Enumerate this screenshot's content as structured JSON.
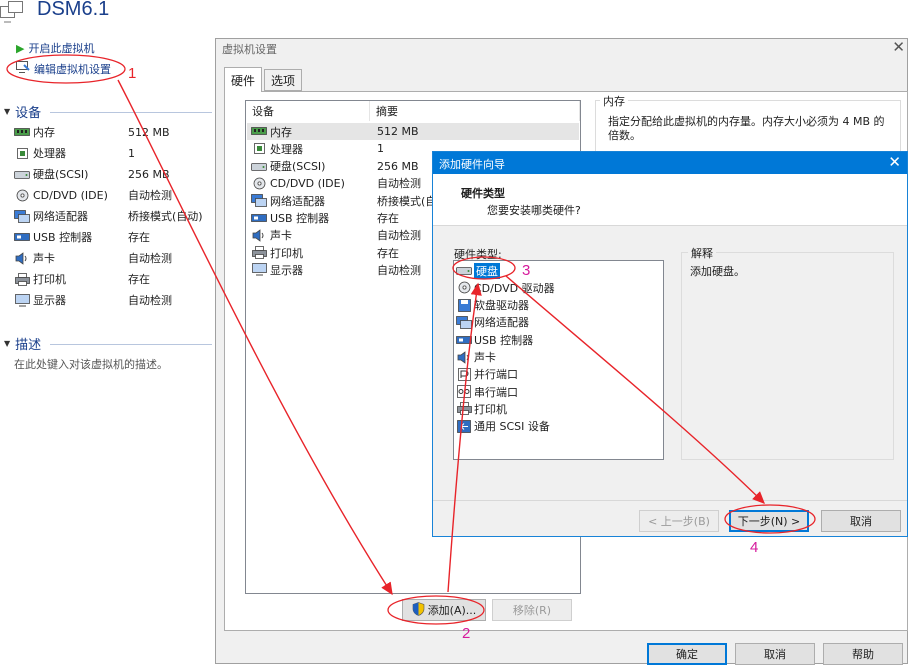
{
  "vm": {
    "title": "DSM6.1",
    "actions": {
      "power_on": "开启此虚拟机",
      "edit_settings": "编辑虚拟机设置"
    }
  },
  "devices_section": {
    "title": "设备",
    "items": [
      {
        "icon": "memory-icon",
        "name": "内存",
        "value": "512 MB"
      },
      {
        "icon": "cpu-icon",
        "name": "处理器",
        "value": "1"
      },
      {
        "icon": "hdd-icon",
        "name": "硬盘(SCSI)",
        "value": "256 MB"
      },
      {
        "icon": "cdrom-icon",
        "name": "CD/DVD (IDE)",
        "value": "自动检测"
      },
      {
        "icon": "network-icon",
        "name": "网络适配器",
        "value": "桥接模式(自动)"
      },
      {
        "icon": "usb-icon",
        "name": "USB 控制器",
        "value": "存在"
      },
      {
        "icon": "sound-icon",
        "name": "声卡",
        "value": "自动检测"
      },
      {
        "icon": "printer-icon",
        "name": "打印机",
        "value": "存在"
      },
      {
        "icon": "display-icon",
        "name": "显示器",
        "value": "自动检测"
      }
    ]
  },
  "description_section": {
    "title": "描述",
    "placeholder": "在此处键入对该虚拟机的描述。"
  },
  "settings_dialog": {
    "title": "虚拟机设置",
    "tabs": [
      "硬件",
      "选项"
    ],
    "columns": [
      "设备",
      "摘要"
    ],
    "rows": [
      {
        "icon": "memory-icon",
        "name": "内存",
        "value": "512 MB"
      },
      {
        "icon": "cpu-icon",
        "name": "处理器",
        "value": "1"
      },
      {
        "icon": "hdd-icon",
        "name": "硬盘(SCSI)",
        "value": "256 MB"
      },
      {
        "icon": "cdrom-icon",
        "name": "CD/DVD (IDE)",
        "value": "自动检测"
      },
      {
        "icon": "network-icon",
        "name": "网络适配器",
        "value": "桥接模式(自动)"
      },
      {
        "icon": "usb-icon",
        "name": "USB 控制器",
        "value": "存在"
      },
      {
        "icon": "sound-icon",
        "name": "声卡",
        "value": "自动检测"
      },
      {
        "icon": "printer-icon",
        "name": "打印机",
        "value": "存在"
      },
      {
        "icon": "display-icon",
        "name": "显示器",
        "value": "自动检测"
      }
    ],
    "memory_group": {
      "title": "内存",
      "desc": "指定分配给此虚拟机的内存量。内存大小必须为 4 MB 的倍数。"
    },
    "buttons": {
      "add": "添加(A)...",
      "remove": "移除(R)",
      "ok": "确定",
      "cancel": "取消",
      "help": "帮助"
    }
  },
  "wizard": {
    "title": "添加硬件向导",
    "heading": "硬件类型",
    "subheading": "您要安装哪类硬件?",
    "list_label": "硬件类型:",
    "hardware_types": [
      {
        "icon": "hdd-icon",
        "label": "硬盘"
      },
      {
        "icon": "cdrom-icon",
        "label": "CD/DVD 驱动器"
      },
      {
        "icon": "floppy-icon",
        "label": "软盘驱动器"
      },
      {
        "icon": "network-icon",
        "label": "网络适配器"
      },
      {
        "icon": "usb-icon",
        "label": "USB 控制器"
      },
      {
        "icon": "sound-icon",
        "label": "声卡"
      },
      {
        "icon": "parallel-port-icon",
        "label": "并行端口"
      },
      {
        "icon": "serial-port-icon",
        "label": "串行端口"
      },
      {
        "icon": "printer-icon",
        "label": "打印机"
      },
      {
        "icon": "scsi-icon",
        "label": "通用 SCSI 设备"
      }
    ],
    "explain_title": "解释",
    "explain_text": "添加硬盘。",
    "buttons": {
      "back": "< 上一步(B)",
      "next": "下一步(N) >",
      "cancel": "取消"
    }
  },
  "annotations": {
    "color": "#e8242a",
    "number_color_1": "#e8242a",
    "number_color_2": "#d61a9c",
    "labels": [
      "1",
      "2",
      "3",
      "4"
    ]
  },
  "colors": {
    "accent": "#0078d7",
    "title_blue": "#1a3f8b"
  }
}
